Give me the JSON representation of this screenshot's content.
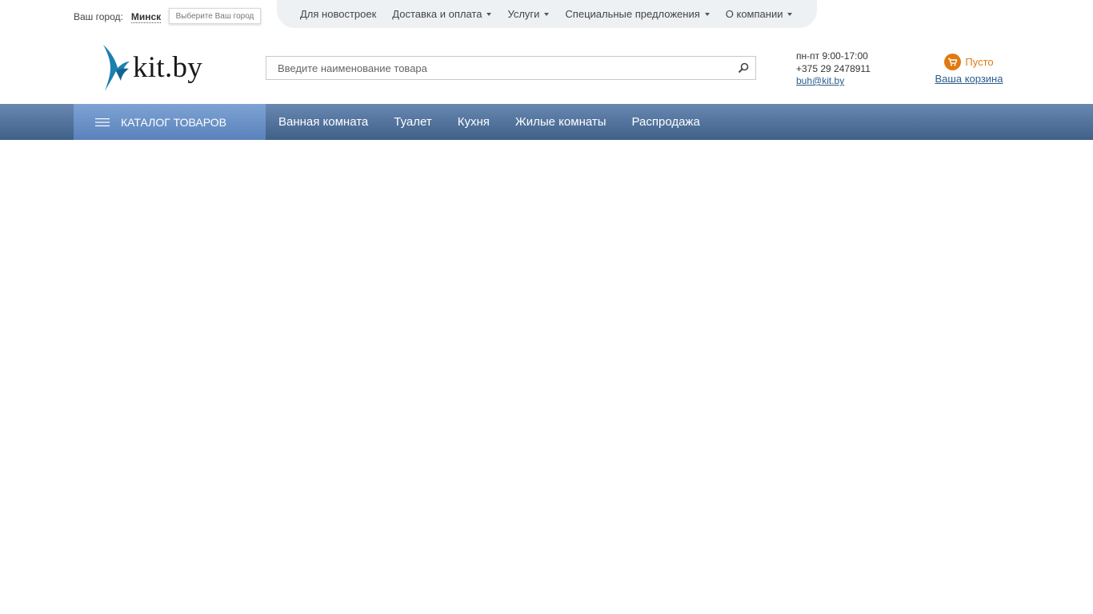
{
  "city": {
    "label": "Ваш город:",
    "name": "Минск",
    "chooser": "Выберите Ваш город"
  },
  "topnav": {
    "items": [
      {
        "label": "Для новостроек",
        "has_dropdown": false
      },
      {
        "label": "Доставка и оплата",
        "has_dropdown": true
      },
      {
        "label": "Услуги",
        "has_dropdown": true
      },
      {
        "label": "Специальные предложения",
        "has_dropdown": true
      },
      {
        "label": "О компании",
        "has_dropdown": true
      }
    ]
  },
  "logo": {
    "text": "kit.by",
    "icon": "fish-tail-icon",
    "color": "#1b7fb0"
  },
  "search": {
    "placeholder": "Введите наименование товара",
    "value": "",
    "icon": "search-icon"
  },
  "contacts": {
    "hours": "пн-пт 9:00-17:00",
    "phone": "+375 29 2478911",
    "email": "buh@kit.by"
  },
  "cart": {
    "icon": "cart-icon",
    "status": "Пусто",
    "link": "Ваша корзина",
    "accent": "#e07a10"
  },
  "mainnav": {
    "catalog_label": "КАТАЛОГ ТОВАРОВ",
    "items": [
      {
        "label": "Ванная комната"
      },
      {
        "label": "Туалет"
      },
      {
        "label": "Кухня"
      },
      {
        "label": "Жилые комнаты"
      },
      {
        "label": "Распродажа"
      }
    ]
  },
  "colors": {
    "nav_dark": "#3f6089",
    "nav_light": "#6888b2",
    "catalog_bg": "#6d93c8",
    "link": "#2a5d8c"
  }
}
